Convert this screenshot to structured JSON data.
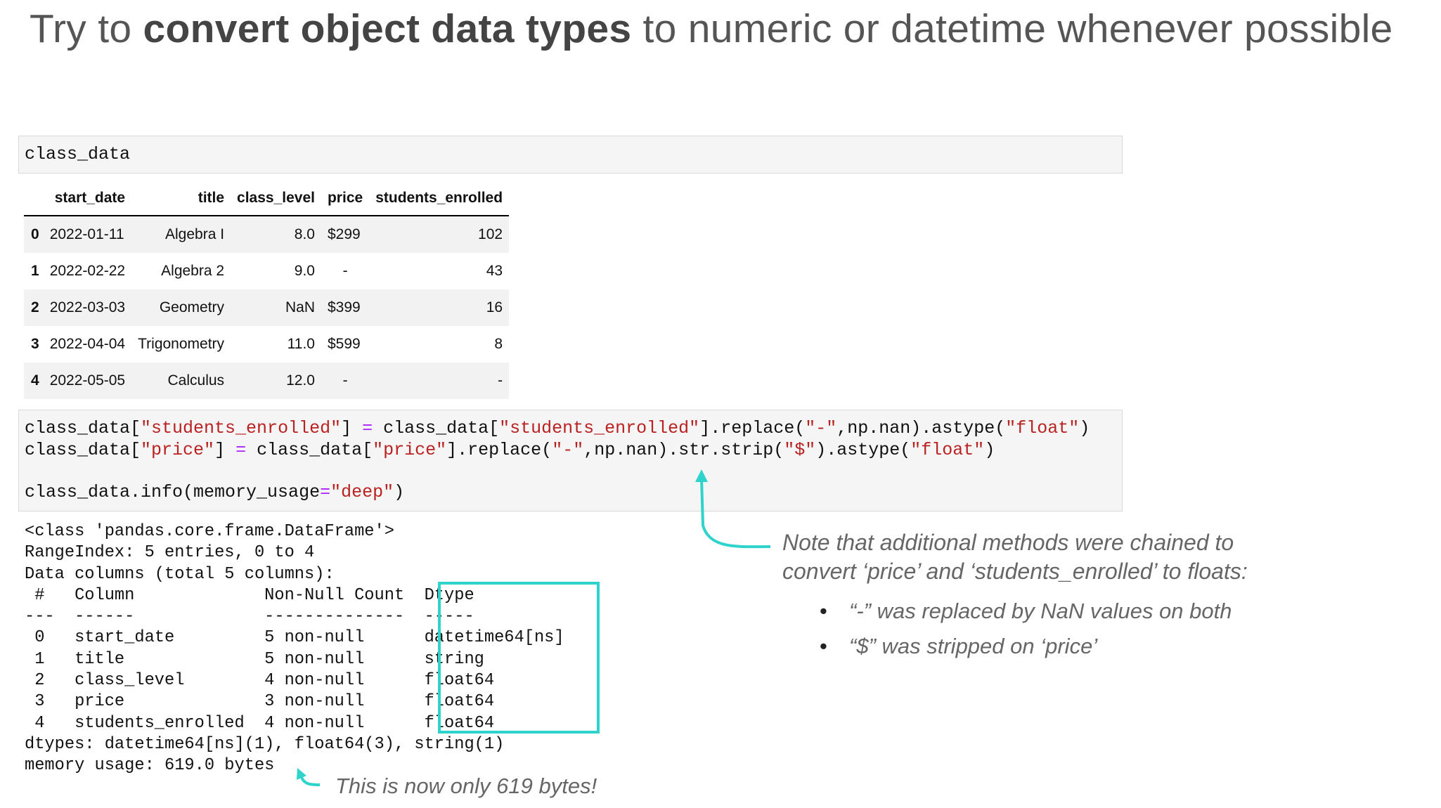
{
  "heading": {
    "pre": "Try to ",
    "bold": "convert object data types",
    "post": " to numeric or datetime whenever possible"
  },
  "cell1": {
    "code": "class_data"
  },
  "dataframe": {
    "columns": [
      "",
      "start_date",
      "title",
      "class_level",
      "price",
      "students_enrolled"
    ],
    "rows": [
      [
        "0",
        "2022-01-11",
        "Algebra I",
        "8.0",
        "$299",
        "102"
      ],
      [
        "1",
        "2022-02-22",
        "Algebra 2",
        "9.0",
        "-",
        "43"
      ],
      [
        "2",
        "2022-03-03",
        "Geometry",
        "NaN",
        "$399",
        "16"
      ],
      [
        "3",
        "2022-04-04",
        "Trigonometry",
        "11.0",
        "$599",
        "8"
      ],
      [
        "4",
        "2022-05-05",
        "Calculus",
        "12.0",
        "-",
        "-"
      ]
    ]
  },
  "cell2": {
    "line1": {
      "a": "class_data[",
      "b": "\"students_enrolled\"",
      "c": "] ",
      "d": "=",
      "e": " class_data[",
      "f": "\"students_enrolled\"",
      "g": "].replace(",
      "h": "\"-\"",
      "i": ",np.nan).astype(",
      "j": "\"float\"",
      "k": ")"
    },
    "line2": {
      "a": "class_data[",
      "b": "\"price\"",
      "c": "] ",
      "d": "=",
      "e": " class_data[",
      "f": "\"price\"",
      "g": "].replace(",
      "h": "\"-\"",
      "i": ",np.nan).str.strip(",
      "j": "\"$\"",
      "k": ").astype(",
      "l": "\"float\"",
      "m": ")"
    },
    "line3": {
      "a": "class_data.info(memory_usage",
      "b": "=",
      "c": "\"deep\"",
      "d": ")"
    }
  },
  "output_lines": [
    "<class 'pandas.core.frame.DataFrame'>",
    "RangeIndex: 5 entries, 0 to 4",
    "Data columns (total 5 columns):",
    " #   Column             Non-Null Count  Dtype",
    "---  ------             --------------  -----",
    " 0   start_date         5 non-null      datetime64[ns]",
    " 1   title              5 non-null      string",
    " 2   class_level        4 non-null      float64",
    " 3   price              3 non-null      float64",
    " 4   students_enrolled  4 non-null      float64",
    "dtypes: datetime64[ns](1), float64(3), string(1)",
    "memory usage: 619.0 bytes"
  ],
  "note": {
    "line1": "Note that additional methods were chained to",
    "line2": "convert ‘price’ and ‘students_enrolled’ to floats:",
    "bullets": [
      "“-” was replaced by NaN values on both",
      "“$” was stripped on ‘price’"
    ]
  },
  "bytes_note": "This is now only 619 bytes!",
  "colors": {
    "highlight": "#2ed3cb",
    "string": "#ba2121",
    "operator": "#aa22ff"
  }
}
